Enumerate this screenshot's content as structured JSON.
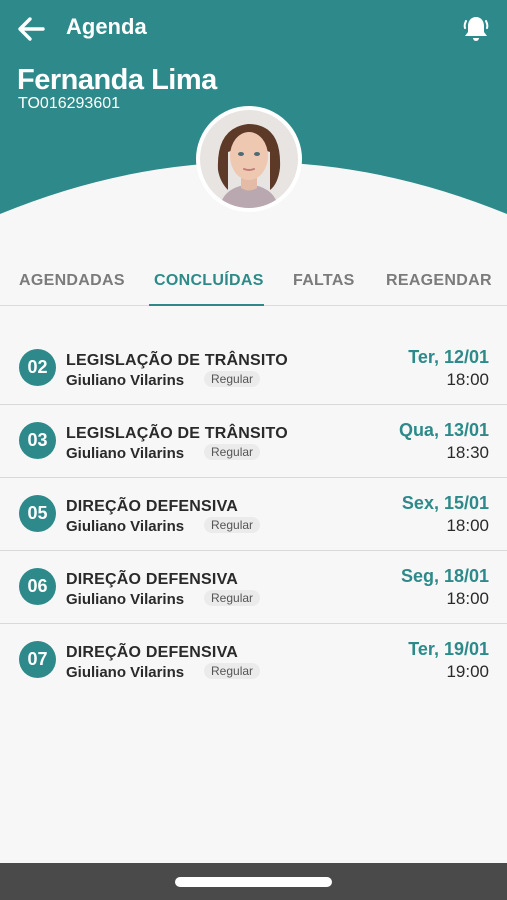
{
  "colors": {
    "accent": "#2e8a8a",
    "header_bg": "#2e8a8a"
  },
  "header": {
    "title": "Agenda",
    "back_icon": "arrow-left-icon",
    "notification_icon": "bell-icon",
    "user_name": "Fernanda Lima",
    "user_id": "TO016293601"
  },
  "tabs": [
    {
      "label": "AGENDADAS",
      "active": false
    },
    {
      "label": "CONCLUÍDAS",
      "active": true
    },
    {
      "label": "FALTAS",
      "active": false
    },
    {
      "label": "REAGENDAR",
      "active": false
    }
  ],
  "lessons": [
    {
      "number": "02",
      "course": "LEGISLAÇÃO DE TRÂNSITO",
      "instructor": "Giuliano Vilarins",
      "type": "Regular",
      "date": "Ter, 12/01",
      "time": "18:00"
    },
    {
      "number": "03",
      "course": "LEGISLAÇÃO DE TRÂNSITO",
      "instructor": "Giuliano Vilarins",
      "type": "Regular",
      "date": "Qua, 13/01",
      "time": "18:30"
    },
    {
      "number": "05",
      "course": "DIREÇÃO DEFENSIVA",
      "instructor": "Giuliano Vilarins",
      "type": "Regular",
      "date": "Sex, 15/01",
      "time": "18:00"
    },
    {
      "number": "06",
      "course": "DIREÇÃO DEFENSIVA",
      "instructor": "Giuliano Vilarins",
      "type": "Regular",
      "date": "Seg, 18/01",
      "time": "18:00"
    },
    {
      "number": "07",
      "course": "DIREÇÃO DEFENSIVA",
      "instructor": "Giuliano Vilarins",
      "type": "Regular",
      "date": "Ter, 19/01",
      "time": "19:00"
    }
  ]
}
